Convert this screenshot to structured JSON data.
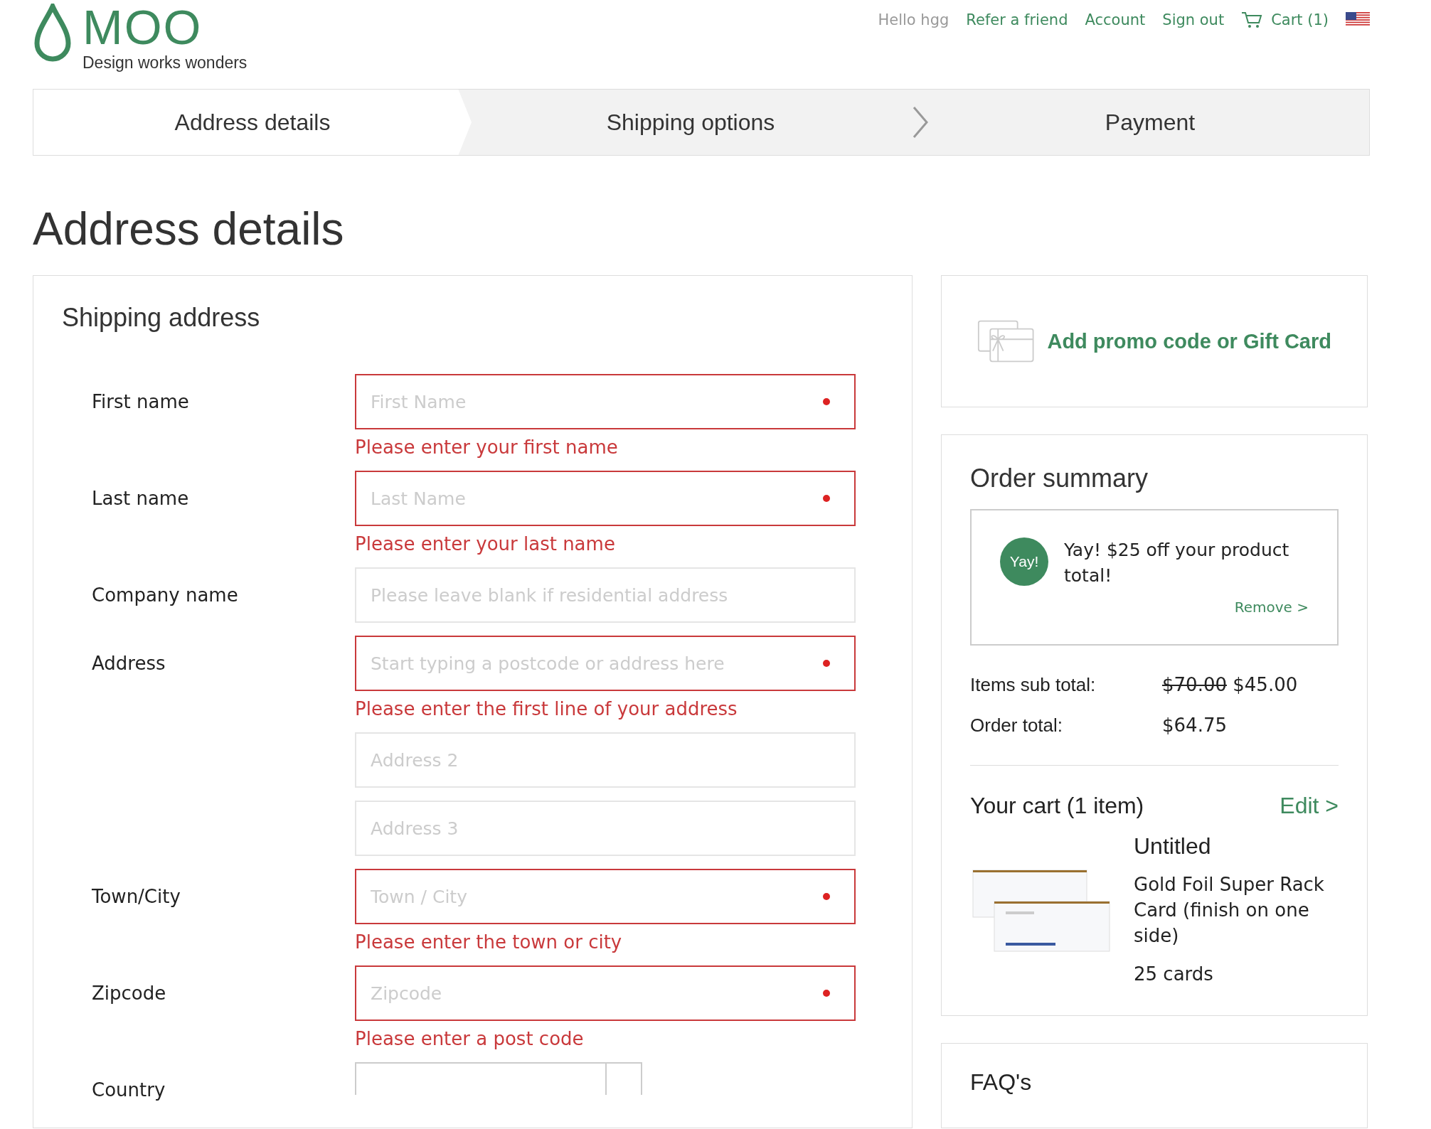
{
  "header": {
    "logo": "MOO",
    "tagline": "Design works wonders",
    "greeting": "Hello hgg",
    "links": [
      {
        "label": "Refer a friend"
      },
      {
        "label": "Account"
      },
      {
        "label": "Sign out"
      }
    ],
    "cart": "Cart (1)"
  },
  "steps": [
    {
      "label": "Address details",
      "selected": true
    },
    {
      "label": "Shipping options",
      "selected": false
    },
    {
      "label": "Payment",
      "selected": false
    }
  ],
  "title": "Address details",
  "shipping": {
    "title": "Shipping address",
    "fields": [
      {
        "kind": "text",
        "label": "First name",
        "placeholder": "First Name",
        "invalid": true,
        "error": "Please enter your first name"
      },
      {
        "kind": "text",
        "label": "Last name",
        "placeholder": "Last Name",
        "invalid": true,
        "error": "Please enter your last name"
      },
      {
        "kind": "text",
        "label": "Company name",
        "placeholder": "Please leave blank if residential address",
        "invalid": false
      },
      {
        "kind": "text",
        "label": "Address",
        "placeholder": "Start typing a postcode or address here",
        "invalid": true,
        "error": "Please enter the first line of your address"
      },
      {
        "kind": "text",
        "placeholder": "Address 2",
        "invalid": false
      },
      {
        "kind": "text",
        "placeholder": "Address 3",
        "invalid": false
      },
      {
        "kind": "text",
        "label": "Town/City",
        "placeholder": "Town / City",
        "invalid": true,
        "error": "Please enter the town or city"
      },
      {
        "kind": "text",
        "label": "Zipcode",
        "placeholder": "Zipcode",
        "invalid": true,
        "error": "Please enter a post code"
      },
      {
        "kind": "select",
        "label": "Country",
        "invalid": false
      }
    ]
  },
  "promo": {
    "label": "Add promo code or Gift Card"
  },
  "summary": {
    "title": "Order summary",
    "badge": "Yay!",
    "discount": "Yay! $25 off your product total!",
    "remove": "Remove >",
    "totals": [
      {
        "label": "Items sub total:",
        "old": "$70.00",
        "value": "$45.00"
      },
      {
        "label": "Order total:",
        "value": "$64.75"
      }
    ],
    "cart_title": "Your cart (1 item)",
    "edit": "Edit >",
    "item": {
      "name": "Untitled",
      "product": "Gold Foil Super Rack Card (finish on one side)",
      "quantity": "25 cards"
    }
  },
  "faq": {
    "title": "FAQ's"
  }
}
